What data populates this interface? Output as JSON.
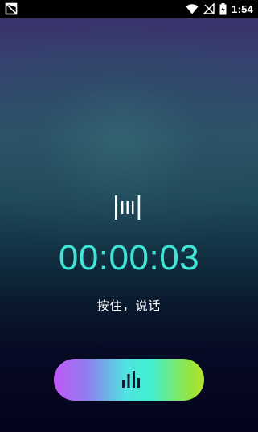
{
  "status_bar": {
    "time": "1:54",
    "icons": [
      "no-sim-icon",
      "wifi-icon",
      "signal-off-icon",
      "battery-charging-icon"
    ]
  },
  "recorder": {
    "indicator_icon": "audio-wave-icon",
    "elapsed": "00:00:03",
    "hint": "按住，说话",
    "button_icon": "equalizer-icon"
  },
  "colors": {
    "timer": "#3fe6d7",
    "button_gradient": [
      "#c257f5",
      "#4fe3e0",
      "#b2e326"
    ]
  }
}
